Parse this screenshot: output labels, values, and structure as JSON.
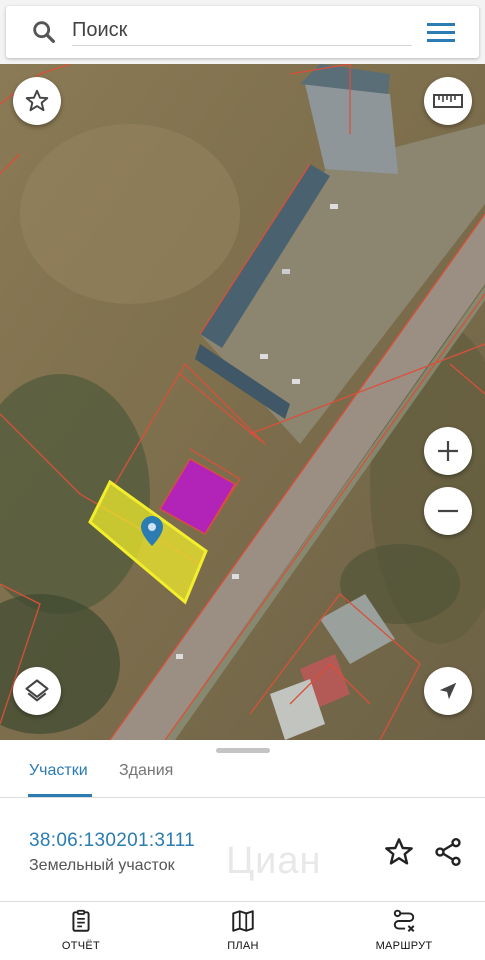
{
  "search": {
    "placeholder": "Поиск"
  },
  "icons": {
    "search": "search-icon",
    "menu": "menu-icon",
    "favorite": "star-icon",
    "ruler": "ruler-icon",
    "zoom_in": "plus-icon",
    "zoom_out": "minus-icon",
    "layers": "layers-icon",
    "locate": "navigation-arrow-icon",
    "share": "share-icon",
    "report": "clipboard-icon",
    "plan": "map-icon",
    "route": "route-icon"
  },
  "colors": {
    "accent": "#2a7cb2",
    "parcel_selected": "#f2ee2b",
    "parcel_building": "#b224b8",
    "cadastral_lines": "#d9503a"
  },
  "tabs": [
    {
      "label": "Участки",
      "active": true
    },
    {
      "label": "Здания",
      "active": false
    }
  ],
  "parcel": {
    "number": "38:06:130201:3111",
    "type": "Земельный участок"
  },
  "watermark": "Циан",
  "nav": [
    {
      "label": "ОТЧЁТ"
    },
    {
      "label": "ПЛАН"
    },
    {
      "label": "МАРШРУТ"
    }
  ]
}
